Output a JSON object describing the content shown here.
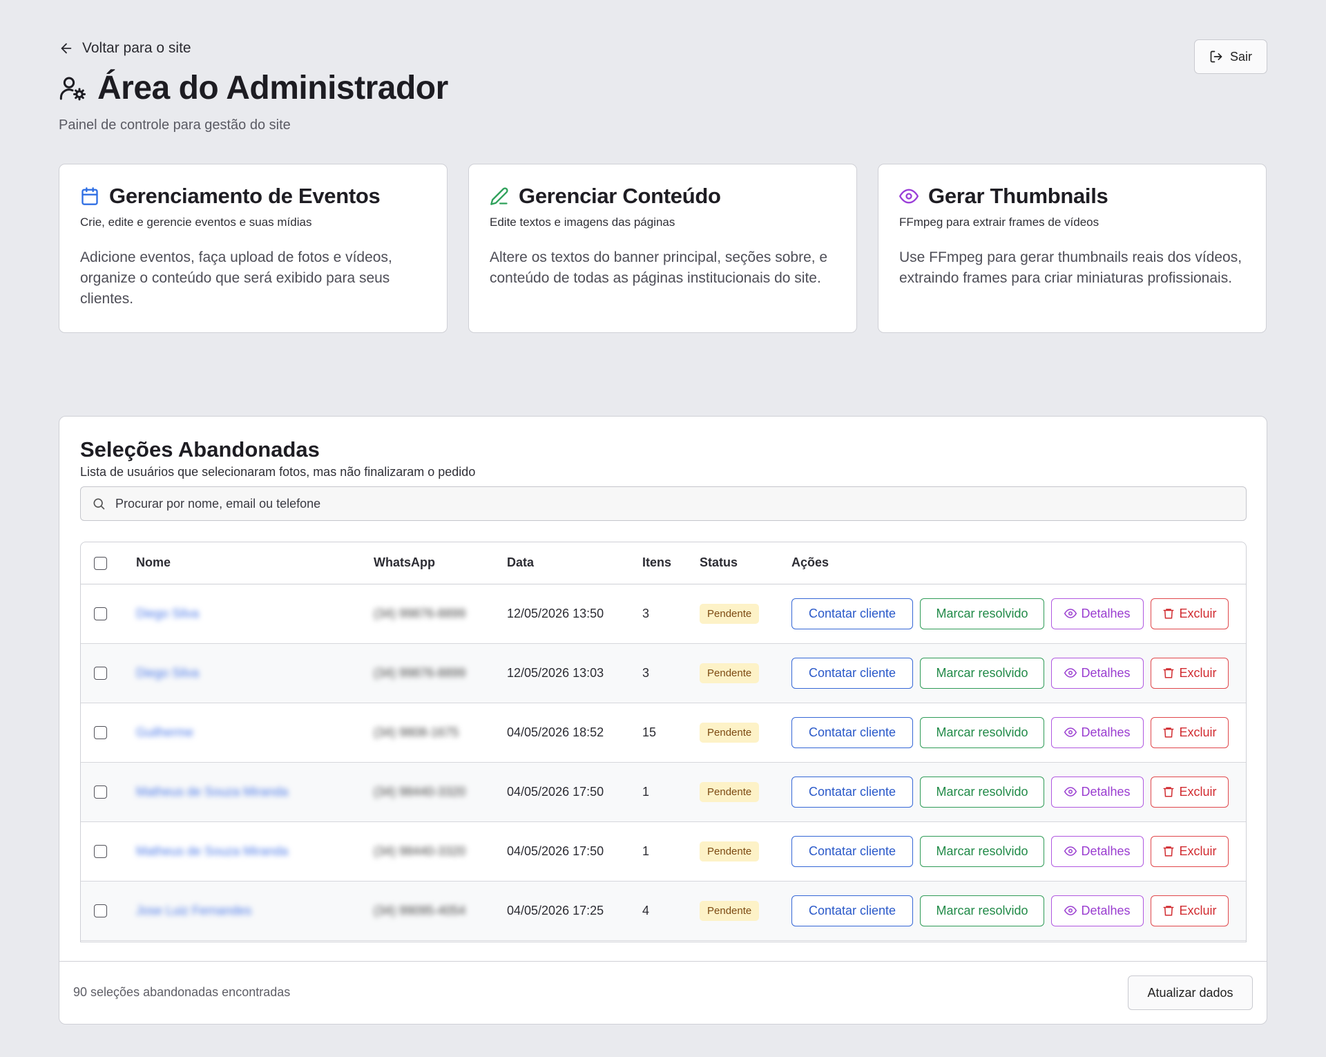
{
  "header": {
    "back_label": "Voltar para o site",
    "title": "Área do Administrador",
    "subtitle": "Painel de controle para gestão do site",
    "logout_label": "Sair"
  },
  "cards": [
    {
      "title": "Gerenciamento de Eventos",
      "subtitle": "Crie, edite e gerencie eventos e suas mídias",
      "body": "Adicione eventos, faça upload de fotos e vídeos, organize o conteúdo que será exibido para seus clientes.",
      "icon": "calendar-icon",
      "color": "#2f6fe4"
    },
    {
      "title": "Gerenciar Conteúdo",
      "subtitle": "Edite textos e imagens das páginas",
      "body": "Altere os textos do banner principal, seções sobre, e conteúdo de todas as páginas institucionais do site.",
      "icon": "pencil-icon",
      "color": "#2ea15a"
    },
    {
      "title": "Gerar Thumbnails",
      "subtitle": "FFmpeg para extrair frames de vídeos",
      "body": "Use FFmpeg para gerar thumbnails reais dos vídeos, extraindo frames para criar miniaturas profissionais.",
      "icon": "eye-icon",
      "color": "#9b3fd8"
    }
  ],
  "abandoned": {
    "title": "Seleções Abandonadas",
    "subtitle": "Lista de usuários que selecionaram fotos, mas não finalizaram o pedido",
    "search_placeholder": "Procurar por nome, email ou telefone",
    "columns": {
      "name": "Nome",
      "whatsapp": "WhatsApp",
      "date": "Data",
      "items": "Itens",
      "status": "Status",
      "actions": "Ações"
    },
    "actions": {
      "contact": "Contatar cliente",
      "resolve": "Marcar resolvido",
      "details": "Detalhes",
      "delete": "Excluir"
    },
    "rows": [
      {
        "name": "Diego Silva",
        "phone": "(34) 99876-8899",
        "date": "12/05/2026 13:50",
        "items": "3",
        "status": "Pendente"
      },
      {
        "name": "Diego Silva",
        "phone": "(34) 99876-8899",
        "date": "12/05/2026 13:03",
        "items": "3",
        "status": "Pendente"
      },
      {
        "name": "Guilherme",
        "phone": "(34) 9808-1675",
        "date": "04/05/2026 18:52",
        "items": "15",
        "status": "Pendente"
      },
      {
        "name": "Matheus de Souza Miranda",
        "phone": "(34) 98440-3320",
        "date": "04/05/2026 17:50",
        "items": "1",
        "status": "Pendente"
      },
      {
        "name": "Matheus de Souza Miranda",
        "phone": "(34) 98440-3320",
        "date": "04/05/2026 17:50",
        "items": "1",
        "status": "Pendente"
      },
      {
        "name": "Jose Luiz Fernandes",
        "phone": "(34) 99095-4054",
        "date": "04/05/2026 17:25",
        "items": "4",
        "status": "Pendente"
      }
    ],
    "footer_count": "90 seleções abandonadas encontradas",
    "refresh_label": "Atualizar dados"
  }
}
